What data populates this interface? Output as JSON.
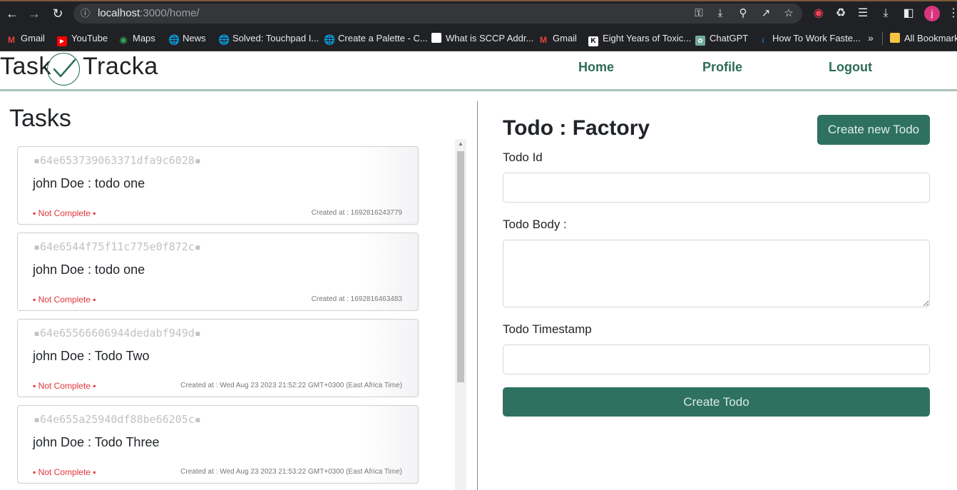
{
  "browser": {
    "url_host": "localhost",
    "url_path": ":3000/home/",
    "avatar_letter": "j",
    "bookmarks": [
      {
        "label": "Gmail",
        "icon": "gmail-icon",
        "color": "#ea4335"
      },
      {
        "label": "YouTube",
        "icon": "youtube-icon",
        "color": "#ff0000"
      },
      {
        "label": "Maps",
        "icon": "maps-icon",
        "color": "#34a853"
      },
      {
        "label": "News",
        "icon": "globe-icon",
        "color": "#9aa0a6"
      },
      {
        "label": "Solved: Touchpad I...",
        "icon": "globe-icon",
        "color": "#9aa0a6"
      },
      {
        "label": "Create a Palette - C...",
        "icon": "globe-icon",
        "color": "#9aa0a6"
      },
      {
        "label": "What is SCCP Addr...",
        "icon": "page-icon",
        "color": "#ffffff"
      },
      {
        "label": "Gmail",
        "icon": "gmail-icon",
        "color": "#ea4335"
      },
      {
        "label": "Eight Years of Toxic...",
        "icon": "k-icon",
        "color": "#ffffff"
      },
      {
        "label": "ChatGPT",
        "icon": "chatgpt-icon",
        "color": "#74aa9c"
      },
      {
        "label": "How To Work Faste...",
        "icon": "info-icon",
        "color": "#1a73e8"
      }
    ],
    "overflow_label": "»",
    "all_bookmarks_label": "All Bookmarks"
  },
  "app": {
    "logo_left": "Task",
    "logo_right": "Tracka",
    "nav": {
      "home": "Home",
      "profile": "Profile",
      "logout": "Logout"
    }
  },
  "tasks": {
    "title": "Tasks",
    "items": [
      {
        "id": "64e653739063371dfa9c6028",
        "title": "john Doe : todo one",
        "status": "Not Complete",
        "created": "Created at : 1692816243779"
      },
      {
        "id": "64e6544f75f11c775e0f872c",
        "title": "john Doe : todo one",
        "status": "Not Complete",
        "created": "Created at : 1692816463483"
      },
      {
        "id": "64e65566606944dedabf949d",
        "title": "john Doe : Todo Two",
        "status": "Not Complete",
        "created": "Created at : Wed Aug 23 2023 21:52:22 GMT+0300 (East Africa Time)"
      },
      {
        "id": "64e655a25940df88be66205c",
        "title": "john Doe : Todo Three",
        "status": "Not Complete",
        "created": "Created at : Wed Aug 23 2023 21:53:22 GMT+0300 (East Africa Time)"
      }
    ]
  },
  "form": {
    "title": "Todo : Factory",
    "create_new_label": "Create new Todo",
    "id_label": "Todo Id",
    "id_value": "",
    "body_label": "Todo Body :",
    "body_value": "",
    "timestamp_label": "Todo Timestamp",
    "timestamp_value": "",
    "submit_label": "Create Todo"
  },
  "colors": {
    "brand_green": "#2f7160",
    "nav_link": "#2e6b57",
    "status_red": "#e0353a"
  }
}
